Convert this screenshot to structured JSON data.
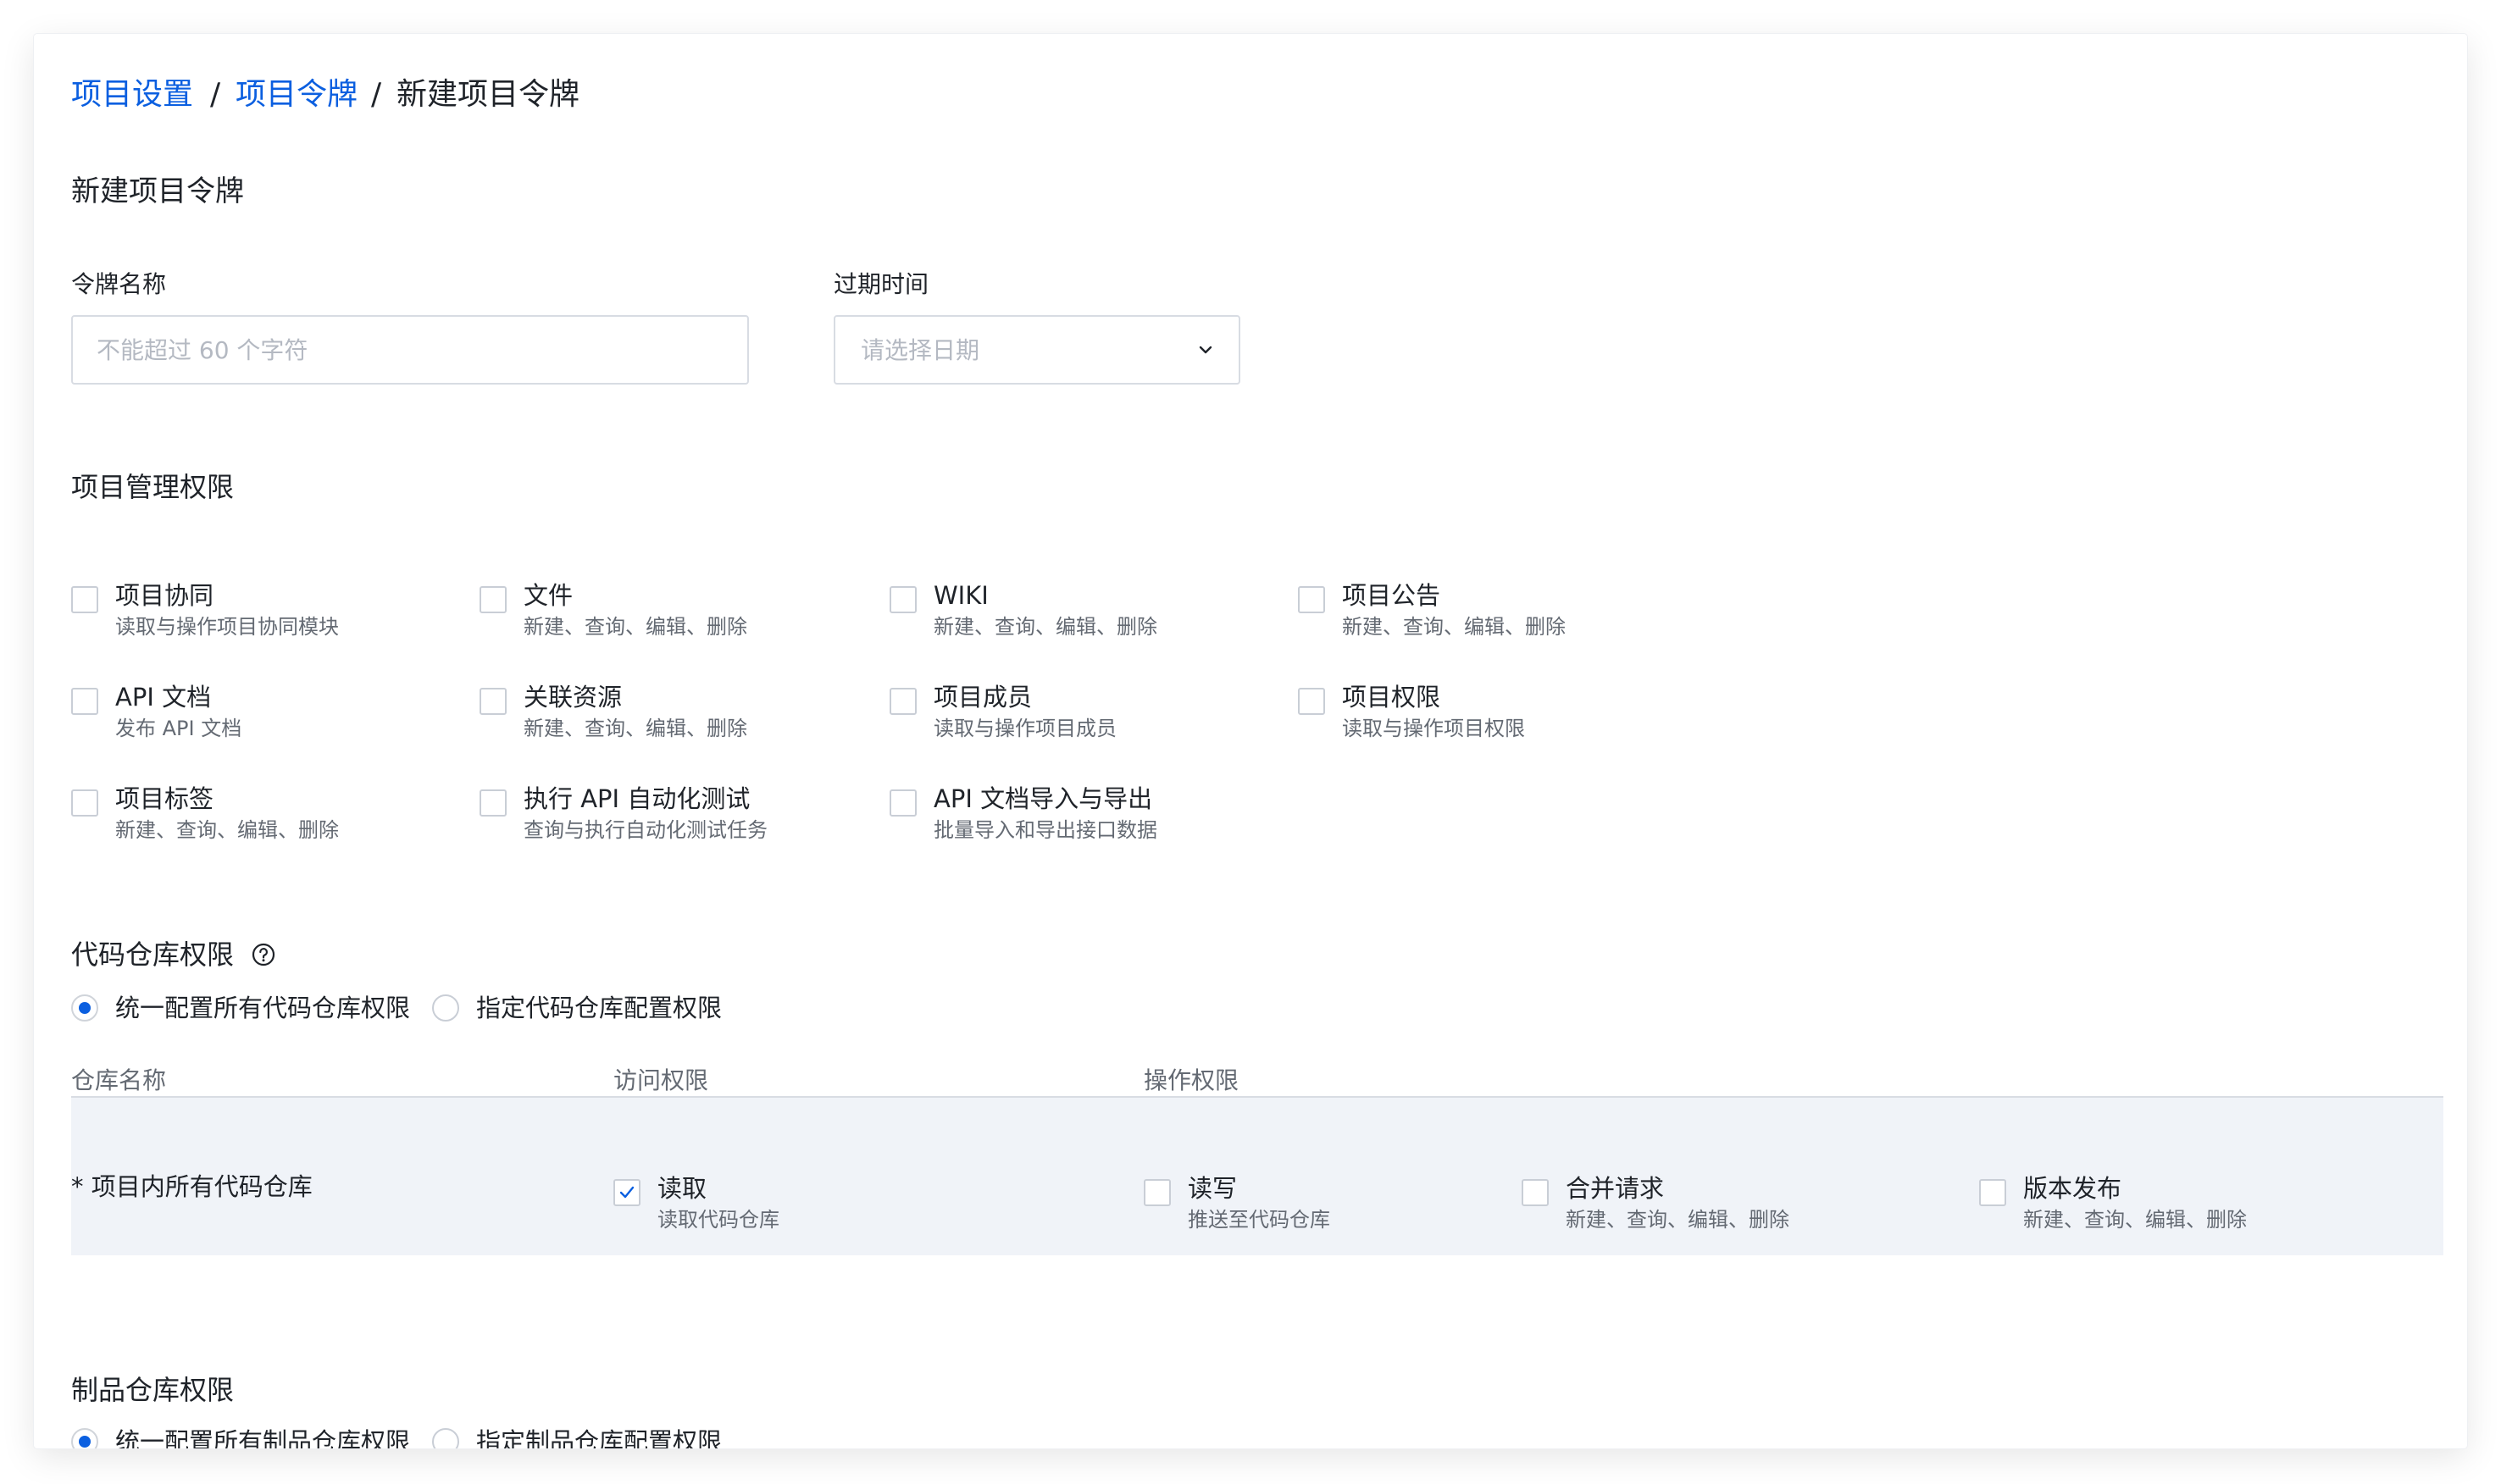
{
  "breadcrumb": {
    "items": [
      "项目设置",
      "项目令牌"
    ],
    "separator": "/",
    "current": "新建项目令牌"
  },
  "page_title": "新建项目令牌",
  "form": {
    "token_name_label": "令牌名称",
    "token_name_placeholder": "不能超过 60 个字符",
    "expire_label": "过期时间",
    "expire_placeholder": "请选择日期"
  },
  "project_perms": {
    "title": "项目管理权限",
    "items": [
      {
        "title": "项目协同",
        "desc": "读取与操作项目协同模块"
      },
      {
        "title": "文件",
        "desc": "新建、查询、编辑、删除"
      },
      {
        "title": "WIKI",
        "desc": "新建、查询、编辑、删除"
      },
      {
        "title": "项目公告",
        "desc": "新建、查询、编辑、删除"
      },
      {
        "title": "API 文档",
        "desc": "发布 API 文档"
      },
      {
        "title": "关联资源",
        "desc": "新建、查询、编辑、删除"
      },
      {
        "title": "项目成员",
        "desc": "读取与操作项目成员"
      },
      {
        "title": "项目权限",
        "desc": "读取与操作项目权限"
      },
      {
        "title": "项目标签",
        "desc": "新建、查询、编辑、删除"
      },
      {
        "title": "执行 API 自动化测试",
        "desc": "查询与执行自动化测试任务"
      },
      {
        "title": "API 文档导入与导出",
        "desc": "批量导入和导出接口数据"
      }
    ]
  },
  "code_repo": {
    "title": "代码仓库权限",
    "radio_all": "统一配置所有代码仓库权限",
    "radio_specific": "指定代码仓库配置权限",
    "col_repo": "仓库名称",
    "col_access": "访问权限",
    "col_ops": "操作权限",
    "row_name": "* 项目内所有代码仓库",
    "perms": [
      {
        "title": "读取",
        "desc": "读取代码仓库",
        "checked": true
      },
      {
        "title": "读写",
        "desc": "推送至代码仓库",
        "checked": false
      },
      {
        "title": "合并请求",
        "desc": "新建、查询、编辑、删除",
        "checked": false
      },
      {
        "title": "版本发布",
        "desc": "新建、查询、编辑、删除",
        "checked": false
      }
    ]
  },
  "artifact_repo": {
    "title": "制品仓库权限",
    "radio_all": "统一配置所有制品仓库权限",
    "radio_specific": "指定制品仓库配置权限"
  },
  "colors": {
    "link": "#0b5fe0",
    "radio_active": "#0b5fe0",
    "row_bg": "#f0f3f8"
  }
}
